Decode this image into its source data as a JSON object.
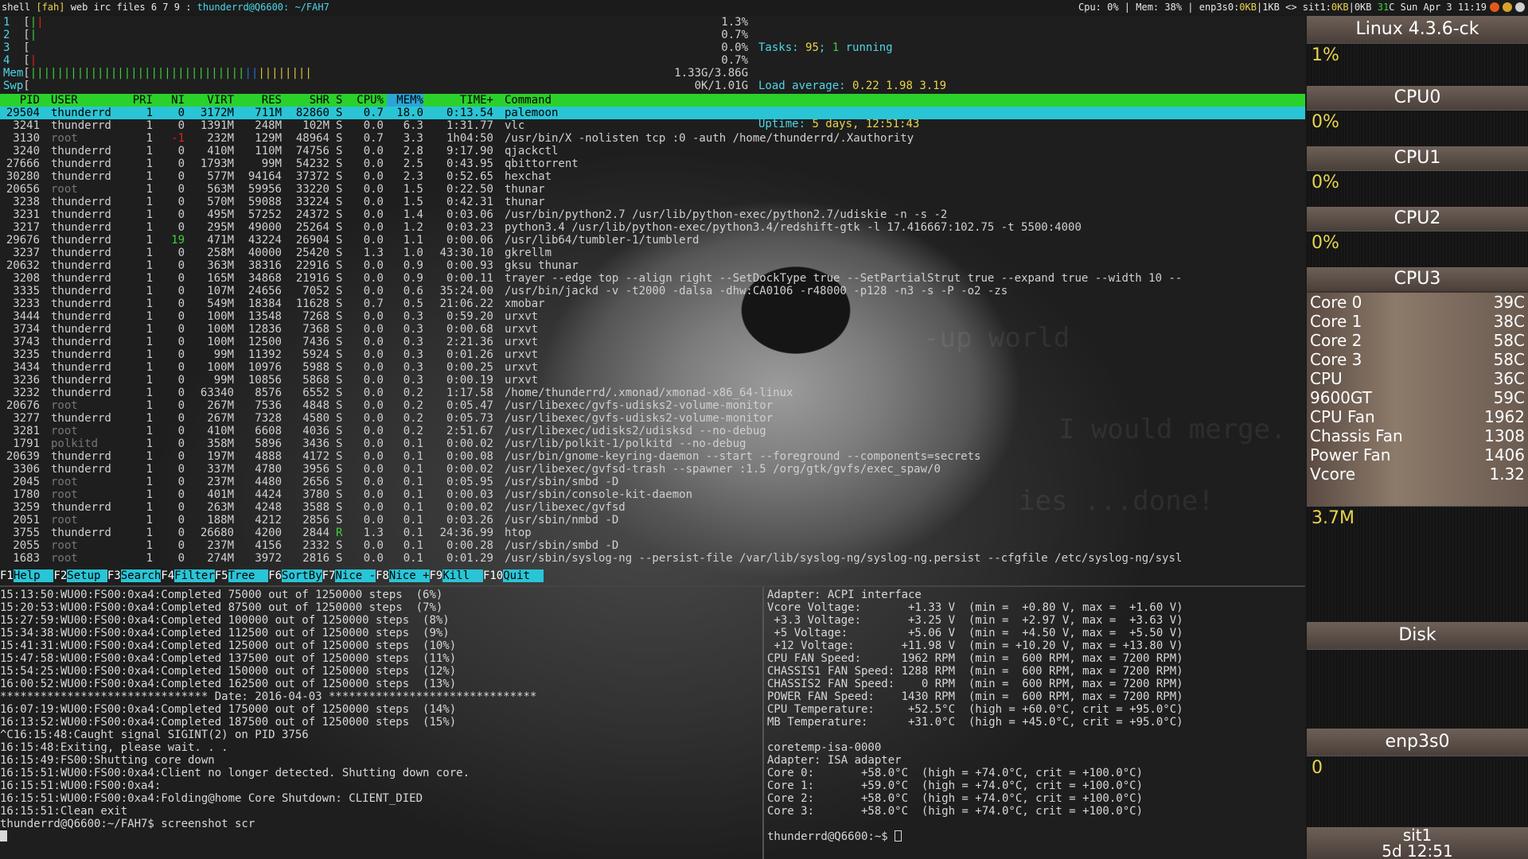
{
  "topbar": {
    "left_pre": "shell ",
    "left_tag": "[fah]",
    "left_mid": " web irc files 6 7 9 : ",
    "left_title": "thunderrd@Q6600: ~/FAH7",
    "right_pre": "Cpu: 0% | Mem: 38% | enp3s0:",
    "right_net1": "0KB",
    "right_mid": "|1KB <> sit1:",
    "right_net2": "0KB",
    "right_mid2": "|0KB ",
    "right_temp": "31",
    "right_post": "C Sun Apr 3 11:19"
  },
  "htop": {
    "meters": [
      {
        "label": "1",
        "val": "1.3%"
      },
      {
        "label": "2",
        "val": "0.7%"
      },
      {
        "label": "3",
        "val": "0.0%"
      },
      {
        "label": "4",
        "val": "0.7%"
      }
    ],
    "mem_label": "Mem",
    "mem_val": "1.33G/3.86G",
    "swp_label": "Swp",
    "swp_val": "0K/1.01G",
    "tasks_label": "Tasks: ",
    "tasks_val": "95",
    "tasks_sep": "; ",
    "tasks_running": "1",
    "tasks_post": " running",
    "load_label": "Load average: ",
    "load_1": "0.22",
    "load_5": "1.98",
    "load_15": "3.19",
    "uptime_label": "Uptime: ",
    "uptime_val": "5 days, 12:51:43",
    "columns": {
      "pid": "PID",
      "user": "USER",
      "pri": "PRI",
      "ni": "NI",
      "virt": "VIRT",
      "res": "RES",
      "shr": "SHR",
      "s": "S",
      "cpu": "CPU%",
      "mem": "MEM%",
      "time": "TIME+",
      "cmd": "Command"
    },
    "processes": [
      {
        "pid": "29504",
        "user": "thunderrd",
        "pri": "1",
        "ni": "0",
        "virt": "3172M",
        "res": "711M",
        "shr": "82860",
        "s": "S",
        "cpu": "0.7",
        "mem": "18.0",
        "time": "0:13.54",
        "cmd": "palemoon",
        "selected": true
      },
      {
        "pid": "3241",
        "user": "thunderrd",
        "pri": "1",
        "ni": "0",
        "virt": "1391M",
        "res": "248M",
        "shr": "102M",
        "s": "S",
        "cpu": "0.0",
        "mem": "6.3",
        "time": "1:31.77",
        "cmd": "vlc"
      },
      {
        "pid": "3130",
        "user": "root",
        "pri": "1",
        "ni": "-1",
        "virt": "232M",
        "res": "129M",
        "shr": "48964",
        "s": "S",
        "cpu": "0.7",
        "mem": "3.3",
        "time": "1h04:50",
        "cmd": "/usr/bin/X -nolisten tcp :0 -auth /home/thunderrd/.Xauthority"
      },
      {
        "pid": "3240",
        "user": "thunderrd",
        "pri": "1",
        "ni": "0",
        "virt": "410M",
        "res": "110M",
        "shr": "74756",
        "s": "S",
        "cpu": "0.0",
        "mem": "2.8",
        "time": "9:17.90",
        "cmd": "qjackctl"
      },
      {
        "pid": "27666",
        "user": "thunderrd",
        "pri": "1",
        "ni": "0",
        "virt": "1793M",
        "res": "99M",
        "shr": "54232",
        "s": "S",
        "cpu": "0.0",
        "mem": "2.5",
        "time": "0:43.95",
        "cmd": "qbittorrent"
      },
      {
        "pid": "30280",
        "user": "thunderrd",
        "pri": "1",
        "ni": "0",
        "virt": "577M",
        "res": "94164",
        "shr": "37372",
        "s": "S",
        "cpu": "0.0",
        "mem": "2.3",
        "time": "0:52.65",
        "cmd": "hexchat"
      },
      {
        "pid": "20656",
        "user": "root",
        "pri": "1",
        "ni": "0",
        "virt": "563M",
        "res": "59956",
        "shr": "33220",
        "s": "S",
        "cpu": "0.0",
        "mem": "1.5",
        "time": "0:22.50",
        "cmd": "thunar"
      },
      {
        "pid": "3238",
        "user": "thunderrd",
        "pri": "1",
        "ni": "0",
        "virt": "570M",
        "res": "59088",
        "shr": "33224",
        "s": "S",
        "cpu": "0.0",
        "mem": "1.5",
        "time": "0:42.31",
        "cmd": "thunar"
      },
      {
        "pid": "3231",
        "user": "thunderrd",
        "pri": "1",
        "ni": "0",
        "virt": "495M",
        "res": "57252",
        "shr": "24372",
        "s": "S",
        "cpu": "0.0",
        "mem": "1.4",
        "time": "0:03.06",
        "cmd": "/usr/bin/python2.7 /usr/lib/python-exec/python2.7/udiskie -n -s -2"
      },
      {
        "pid": "3217",
        "user": "thunderrd",
        "pri": "1",
        "ni": "0",
        "virt": "295M",
        "res": "49000",
        "shr": "25264",
        "s": "S",
        "cpu": "0.0",
        "mem": "1.2",
        "time": "0:03.23",
        "cmd": "python3.4 /usr/lib/python-exec/python3.4/redshift-gtk -l 17.416667:102.75 -t 5500:4000"
      },
      {
        "pid": "29676",
        "user": "thunderrd",
        "pri": "1",
        "ni": "19",
        "virt": "471M",
        "res": "43224",
        "shr": "26904",
        "s": "S",
        "cpu": "0.0",
        "mem": "1.1",
        "time": "0:00.06",
        "cmd": "/usr/lib64/tumbler-1/tumblerd"
      },
      {
        "pid": "3237",
        "user": "thunderrd",
        "pri": "1",
        "ni": "0",
        "virt": "258M",
        "res": "40000",
        "shr": "25420",
        "s": "S",
        "cpu": "1.3",
        "mem": "1.0",
        "time": "43:30.10",
        "cmd": "gkrellm"
      },
      {
        "pid": "20632",
        "user": "thunderrd",
        "pri": "1",
        "ni": "0",
        "virt": "363M",
        "res": "38316",
        "shr": "22916",
        "s": "S",
        "cpu": "0.0",
        "mem": "0.9",
        "time": "0:00.93",
        "cmd": "gksu thunar"
      },
      {
        "pid": "3208",
        "user": "thunderrd",
        "pri": "1",
        "ni": "0",
        "virt": "165M",
        "res": "34868",
        "shr": "21916",
        "s": "S",
        "cpu": "0.0",
        "mem": "0.9",
        "time": "0:00.11",
        "cmd": "trayer --edge top --align right --SetDockType true --SetPartialStrut true --expand true --width 10 --"
      },
      {
        "pid": "3335",
        "user": "thunderrd",
        "pri": "1",
        "ni": "0",
        "virt": "107M",
        "res": "24656",
        "shr": "7052",
        "s": "S",
        "cpu": "0.0",
        "mem": "0.6",
        "time": "35:24.00",
        "cmd": "/usr/bin/jackd -v -t2000 -dalsa -dhw:CA0106 -r48000 -p128 -n3 -s -P -o2 -zs"
      },
      {
        "pid": "3233",
        "user": "thunderrd",
        "pri": "1",
        "ni": "0",
        "virt": "549M",
        "res": "18384",
        "shr": "11628",
        "s": "S",
        "cpu": "0.7",
        "mem": "0.5",
        "time": "21:06.22",
        "cmd": "xmobar"
      },
      {
        "pid": "3444",
        "user": "thunderrd",
        "pri": "1",
        "ni": "0",
        "virt": "100M",
        "res": "13548",
        "shr": "7268",
        "s": "S",
        "cpu": "0.0",
        "mem": "0.3",
        "time": "0:59.20",
        "cmd": "urxvt"
      },
      {
        "pid": "3734",
        "user": "thunderrd",
        "pri": "1",
        "ni": "0",
        "virt": "100M",
        "res": "12836",
        "shr": "7368",
        "s": "S",
        "cpu": "0.0",
        "mem": "0.3",
        "time": "0:00.68",
        "cmd": "urxvt"
      },
      {
        "pid": "3743",
        "user": "thunderrd",
        "pri": "1",
        "ni": "0",
        "virt": "100M",
        "res": "12500",
        "shr": "7436",
        "s": "S",
        "cpu": "0.0",
        "mem": "0.3",
        "time": "2:21.36",
        "cmd": "urxvt"
      },
      {
        "pid": "3235",
        "user": "thunderrd",
        "pri": "1",
        "ni": "0",
        "virt": "99M",
        "res": "11392",
        "shr": "5924",
        "s": "S",
        "cpu": "0.0",
        "mem": "0.3",
        "time": "0:01.26",
        "cmd": "urxvt"
      },
      {
        "pid": "3434",
        "user": "thunderrd",
        "pri": "1",
        "ni": "0",
        "virt": "100M",
        "res": "10976",
        "shr": "5988",
        "s": "S",
        "cpu": "0.0",
        "mem": "0.3",
        "time": "0:00.25",
        "cmd": "urxvt"
      },
      {
        "pid": "3236",
        "user": "thunderrd",
        "pri": "1",
        "ni": "0",
        "virt": "99M",
        "res": "10856",
        "shr": "5868",
        "s": "S",
        "cpu": "0.0",
        "mem": "0.3",
        "time": "0:00.19",
        "cmd": "urxvt"
      },
      {
        "pid": "3232",
        "user": "thunderrd",
        "pri": "1",
        "ni": "0",
        "virt": "63340",
        "res": "8576",
        "shr": "6552",
        "s": "S",
        "cpu": "0.0",
        "mem": "0.2",
        "time": "1:17.58",
        "cmd": "/home/thunderrd/.xmonad/xmonad-x86_64-linux"
      },
      {
        "pid": "20676",
        "user": "root",
        "pri": "1",
        "ni": "0",
        "virt": "267M",
        "res": "7536",
        "shr": "4848",
        "s": "S",
        "cpu": "0.0",
        "mem": "0.2",
        "time": "0:05.47",
        "cmd": "/usr/libexec/gvfs-udisks2-volume-monitor"
      },
      {
        "pid": "3277",
        "user": "thunderrd",
        "pri": "1",
        "ni": "0",
        "virt": "267M",
        "res": "7328",
        "shr": "4580",
        "s": "S",
        "cpu": "0.0",
        "mem": "0.2",
        "time": "0:05.73",
        "cmd": "/usr/libexec/gvfs-udisks2-volume-monitor"
      },
      {
        "pid": "3281",
        "user": "root",
        "pri": "1",
        "ni": "0",
        "virt": "410M",
        "res": "6608",
        "shr": "4036",
        "s": "S",
        "cpu": "0.0",
        "mem": "0.2",
        "time": "2:51.67",
        "cmd": "/usr/libexec/udisks2/udisksd --no-debug"
      },
      {
        "pid": "1791",
        "user": "polkitd",
        "pri": "1",
        "ni": "0",
        "virt": "358M",
        "res": "5896",
        "shr": "3436",
        "s": "S",
        "cpu": "0.0",
        "mem": "0.1",
        "time": "0:00.02",
        "cmd": "/usr/lib/polkit-1/polkitd --no-debug"
      },
      {
        "pid": "20639",
        "user": "thunderrd",
        "pri": "1",
        "ni": "0",
        "virt": "197M",
        "res": "4888",
        "shr": "4172",
        "s": "S",
        "cpu": "0.0",
        "mem": "0.1",
        "time": "0:00.08",
        "cmd": "/usr/bin/gnome-keyring-daemon --start --foreground --components=secrets"
      },
      {
        "pid": "3306",
        "user": "thunderrd",
        "pri": "1",
        "ni": "0",
        "virt": "337M",
        "res": "4780",
        "shr": "3956",
        "s": "S",
        "cpu": "0.0",
        "mem": "0.1",
        "time": "0:00.02",
        "cmd": "/usr/libexec/gvfsd-trash --spawner :1.5 /org/gtk/gvfs/exec_spaw/0"
      },
      {
        "pid": "2045",
        "user": "root",
        "pri": "1",
        "ni": "0",
        "virt": "237M",
        "res": "4480",
        "shr": "2656",
        "s": "S",
        "cpu": "0.0",
        "mem": "0.1",
        "time": "0:05.95",
        "cmd": "/usr/sbin/smbd -D"
      },
      {
        "pid": "1780",
        "user": "root",
        "pri": "1",
        "ni": "0",
        "virt": "401M",
        "res": "4424",
        "shr": "3780",
        "s": "S",
        "cpu": "0.0",
        "mem": "0.1",
        "time": "0:00.03",
        "cmd": "/usr/sbin/console-kit-daemon"
      },
      {
        "pid": "3259",
        "user": "thunderrd",
        "pri": "1",
        "ni": "0",
        "virt": "263M",
        "res": "4248",
        "shr": "3588",
        "s": "S",
        "cpu": "0.0",
        "mem": "0.1",
        "time": "0:00.02",
        "cmd": "/usr/libexec/gvfsd"
      },
      {
        "pid": "2051",
        "user": "root",
        "pri": "1",
        "ni": "0",
        "virt": "188M",
        "res": "4212",
        "shr": "2856",
        "s": "S",
        "cpu": "0.0",
        "mem": "0.1",
        "time": "0:03.26",
        "cmd": "/usr/sbin/nmbd -D"
      },
      {
        "pid": "3755",
        "user": "thunderrd",
        "pri": "1",
        "ni": "0",
        "virt": "26680",
        "res": "4200",
        "shr": "2844",
        "s": "R",
        "cpu": "1.3",
        "mem": "0.1",
        "time": "24:36.99",
        "cmd": "htop"
      },
      {
        "pid": "2055",
        "user": "root",
        "pri": "1",
        "ni": "0",
        "virt": "237M",
        "res": "4156",
        "shr": "2332",
        "s": "S",
        "cpu": "0.0",
        "mem": "0.1",
        "time": "0:00.28",
        "cmd": "/usr/sbin/smbd -D"
      },
      {
        "pid": "1683",
        "user": "root",
        "pri": "1",
        "ni": "0",
        "virt": "274M",
        "res": "3972",
        "shr": "2816",
        "s": "S",
        "cpu": "0.0",
        "mem": "0.1",
        "time": "0:01.29",
        "cmd": "/usr/sbin/syslog-ng --persist-file /var/lib/syslog-ng/syslog-ng.persist --cfgfile /etc/syslog-ng/sysl"
      }
    ],
    "fkeys": [
      {
        "key": "F1",
        "label": "Help  "
      },
      {
        "key": "F2",
        "label": "Setup "
      },
      {
        "key": "F3",
        "label": "Search"
      },
      {
        "key": "F4",
        "label": "Filter"
      },
      {
        "key": "F5",
        "label": "Tree  "
      },
      {
        "key": "F6",
        "label": "SortBy"
      },
      {
        "key": "F7",
        "label": "Nice -"
      },
      {
        "key": "F8",
        "label": "Nice +"
      },
      {
        "key": "F9",
        "label": "Kill  "
      },
      {
        "key": "F10",
        "label": "Quit  "
      }
    ]
  },
  "term_left": {
    "lines": [
      "15:13:50:WU00:FS00:0xa4:Completed 75000 out of 1250000 steps  (6%)",
      "15:20:53:WU00:FS00:0xa4:Completed 87500 out of 1250000 steps  (7%)",
      "15:27:59:WU00:FS00:0xa4:Completed 100000 out of 1250000 steps  (8%)",
      "15:34:38:WU00:FS00:0xa4:Completed 112500 out of 1250000 steps  (9%)",
      "15:41:31:WU00:FS00:0xa4:Completed 125000 out of 1250000 steps  (10%)",
      "15:47:58:WU00:FS00:0xa4:Completed 137500 out of 1250000 steps  (11%)",
      "15:54:25:WU00:FS00:0xa4:Completed 150000 out of 1250000 steps  (12%)",
      "16:00:52:WU00:FS00:0xa4:Completed 162500 out of 1250000 steps  (13%)",
      "******************************* Date: 2016-04-03 *******************************",
      "16:07:19:WU00:FS00:0xa4:Completed 175000 out of 1250000 steps  (14%)",
      "16:13:52:WU00:FS00:0xa4:Completed 187500 out of 1250000 steps  (15%)",
      "^C16:15:48:Caught signal SIGINT(2) on PID 3756",
      "16:15:48:Exiting, please wait. . .",
      "16:15:49:FS00:Shutting core down",
      "16:15:51:WU00:FS00:0xa4:Client no longer detected. Shutting down core.",
      "16:15:51:WU00:FS00:0xa4:",
      "16:15:51:WU00:FS00:0xa4:Folding@home Core Shutdown: CLIENT_DIED",
      "16:15:51:Clean exit",
      "thunderrd@Q6600:~/FAH7$ screenshot scr"
    ]
  },
  "term_right": {
    "lines": [
      "Adapter: ACPI interface",
      "Vcore Voltage:       +1.33 V  (min =  +0.80 V, max =  +1.60 V)",
      " +3.3 Voltage:       +3.25 V  (min =  +2.97 V, max =  +3.63 V)",
      " +5 Voltage:         +5.06 V  (min =  +4.50 V, max =  +5.50 V)",
      " +12 Voltage:       +11.98 V  (min = +10.20 V, max = +13.80 V)",
      "CPU FAN Speed:      1962 RPM  (min =  600 RPM, max = 7200 RPM)",
      "CHASSIS1 FAN Speed: 1288 RPM  (min =  600 RPM, max = 7200 RPM)",
      "CHASSIS2 FAN Speed:    0 RPM  (min =  600 RPM, max = 7200 RPM)",
      "POWER FAN Speed:    1430 RPM  (min =  600 RPM, max = 7200 RPM)",
      "CPU Temperature:     +52.5°C  (high = +60.0°C, crit = +95.0°C)",
      "MB Temperature:      +31.0°C  (high = +45.0°C, crit = +95.0°C)",
      "",
      "coretemp-isa-0000",
      "Adapter: ISA adapter",
      "Core 0:       +58.0°C  (high = +74.0°C, crit = +100.0°C)",
      "Core 1:       +59.0°C  (high = +74.0°C, crit = +100.0°C)",
      "Core 2:       +58.0°C  (high = +74.0°C, crit = +100.0°C)",
      "Core 3:       +58.0°C  (high = +74.0°C, crit = +100.0°C)",
      "",
      "thunderrd@Q6600:~$ "
    ]
  },
  "gkrellm": {
    "kernel": "Linux 4.3.6-ck",
    "kernel_pct": "1%",
    "cpus": [
      {
        "name": "CPU0",
        "pct": "0%"
      },
      {
        "name": "CPU1",
        "pct": "0%"
      },
      {
        "name": "CPU2",
        "pct": "0%"
      },
      {
        "name": "CPU3",
        "pct": ""
      }
    ],
    "sensors": [
      {
        "name": "Core 0",
        "value": "39C"
      },
      {
        "name": "Core 1",
        "value": "38C"
      },
      {
        "name": "Core 2",
        "value": "58C"
      },
      {
        "name": "Core 3",
        "value": "58C"
      },
      {
        "name": "CPU",
        "value": "36C"
      },
      {
        "name": "9600GT",
        "value": "59C"
      },
      {
        "name": "CPU Fan",
        "value": "1962"
      },
      {
        "name": "Chassis Fan",
        "value": "1308"
      },
      {
        "name": "Power Fan",
        "value": "1406"
      },
      {
        "name": "Vcore",
        "value": "1.32"
      }
    ],
    "mem_value": "3.7M",
    "disk_label": "Disk",
    "net_label": "enp3s0",
    "net_value": "0",
    "sit_label": "sit1",
    "sit_uptime": "5d 12:51"
  },
  "colors": {
    "accent_green": "#2bd12b",
    "accent_cyan": "#29c5d6",
    "yellow": "#e8d44d"
  }
}
